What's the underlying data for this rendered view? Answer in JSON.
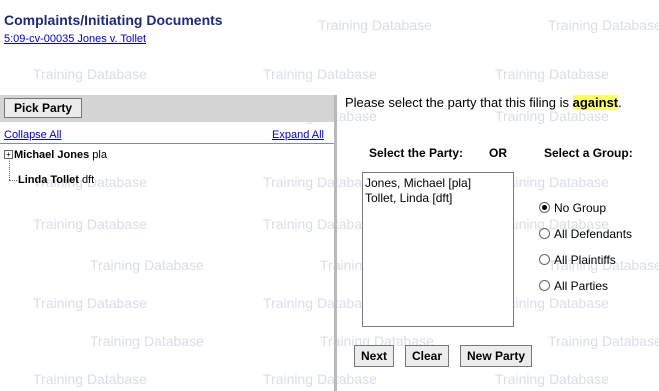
{
  "watermark": "Training Database",
  "header": {
    "title": "Complaints/Initiating Documents",
    "case_link": "5:09-cv-00035 Jones v. Tollet"
  },
  "left_panel": {
    "pick_party_button": "Pick Party",
    "collapse_all": "Collapse All",
    "expand_all": "Expand All",
    "tree": [
      {
        "name": "Michael Jones",
        "role": "pla",
        "expandable": true
      },
      {
        "name": "Linda Tollet",
        "role": "dft",
        "expandable": false
      }
    ]
  },
  "right_panel": {
    "prompt_prefix": "Please select the party that this filing is ",
    "prompt_highlight": "against",
    "prompt_suffix": ".",
    "select_party_label": "Select the Party:",
    "or_label": "OR",
    "select_group_label": "Select a Group:",
    "party_options": [
      "Jones, Michael  [pla]",
      "Tollet, Linda  [dft]"
    ],
    "group_options": [
      {
        "label": "No Group",
        "selected": true
      },
      {
        "label": "All Defendants",
        "selected": false
      },
      {
        "label": "All Plaintiffs",
        "selected": false
      },
      {
        "label": "All Parties",
        "selected": false
      }
    ],
    "buttons": {
      "next": "Next",
      "clear": "Clear",
      "new_party": "New Party"
    }
  },
  "colors": {
    "title": "#1f2a7a",
    "link": "#0000cc",
    "highlight": "#ffff66",
    "watermark": "#d9dde6",
    "panel_bar": "#d4d4d4"
  }
}
